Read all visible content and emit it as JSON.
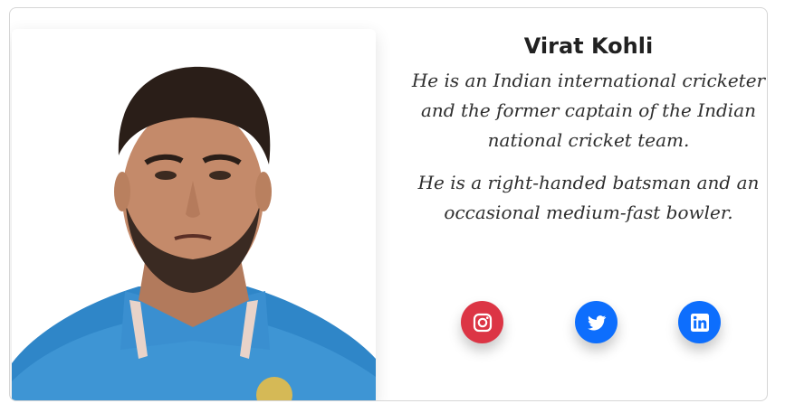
{
  "profile": {
    "name": "Virat Kohli",
    "bio": [
      "He is an Indian international cricketer and the former captain of the Indian national cricket team.",
      "He is a right-handed batsman and an occasional medium-fast bowler."
    ]
  },
  "social": [
    {
      "icon": "instagram-icon",
      "color": "#dc3545"
    },
    {
      "icon": "twitter-icon",
      "color": "#0d6efd"
    },
    {
      "icon": "linkedin-icon",
      "color": "#0d6efd"
    }
  ]
}
